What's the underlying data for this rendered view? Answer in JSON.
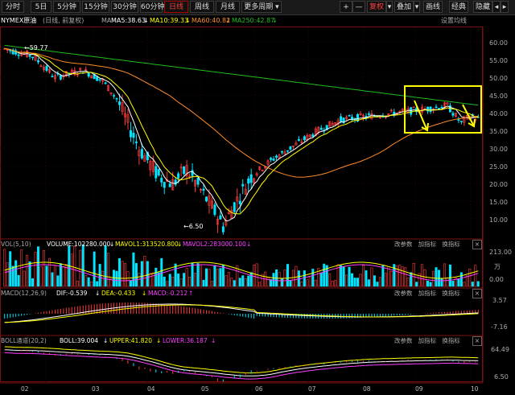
{
  "toolbar": {
    "tabs": [
      "分时",
      "5日",
      "5分钟",
      "15分钟",
      "30分钟",
      "60分钟",
      "日线",
      "周线",
      "月线",
      "更多周期 ▾"
    ],
    "active_tab": "日线",
    "plus": "+",
    "minus": "—",
    "fuquan": "复权",
    "diejia": "叠加",
    "huaxian": "画线",
    "jingdian": "经典",
    "yincang": "隐藏"
  },
  "main": {
    "instrument": "NYMEX原油",
    "period_mode": "(日线, 前复权)",
    "ma_label": "MA",
    "ma5": "MA5:38.63",
    "ma10": "MA10:39.33",
    "ma60": "MA60:40.82",
    "ma250": "MA250:42.87",
    "settings_link": "设置均线",
    "high_marker": "59.77",
    "low_marker": "6.50",
    "y_ticks": [
      "60.00",
      "55.00",
      "50.00",
      "45.00",
      "40.00",
      "35.00",
      "30.00",
      "25.00",
      "20.00",
      "15.00",
      "10.00"
    ]
  },
  "vol": {
    "name": "VOL(5,10)",
    "volume": "VOLUME:102280.000",
    "mavol1": "MAVOL1:313520.800",
    "mavol2": "MAVOL2:283000.100",
    "y_top": "213.00",
    "y_unit": "万",
    "y_bottom": "0.00"
  },
  "macd": {
    "name": "MACD(12,26,9)",
    "dif": "DIF:-0.539",
    "dea": "DEA:-0.433",
    "macd": "MACD:-0.212",
    "y_top": "3.57",
    "y_bottom": "-7.16"
  },
  "boll": {
    "name": "BOLL通道(20,2)",
    "boll": "BOLL:39.004",
    "upper": "UPPER:41.820",
    "lower": "LOWER:36.187",
    "y_top": "64.49",
    "y_bottom": "6.50"
  },
  "panel_tools": [
    "改参数",
    "加指标",
    "换指标"
  ],
  "close_glyph": "×",
  "x_axis": [
    "02",
    "03",
    "04",
    "05",
    "06",
    "07",
    "08",
    "09",
    "10"
  ],
  "colors": {
    "up": "#ff3b3b",
    "down": "#00e5ff",
    "ma5": "#ffffff",
    "ma10": "#ffff00",
    "ma60": "#ff8c28",
    "ma250": "#1fbe1f",
    "highlight": "#ffff00"
  }
}
